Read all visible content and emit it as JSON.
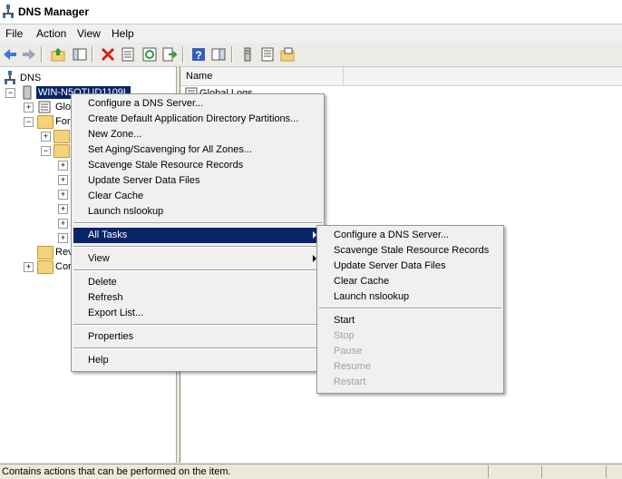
{
  "window": {
    "title": "DNS Manager"
  },
  "menubar": {
    "items": [
      "File",
      "Action",
      "View",
      "Help"
    ]
  },
  "toolbar": {
    "icons": [
      "back-arrow-icon",
      "forward-arrow-icon",
      "up-folder-icon",
      "show-hide-tree-icon",
      "delete-icon",
      "properties-icon",
      "refresh-icon",
      "export-list-icon",
      "help-icon",
      "show-action-pane-icon",
      "server-icon",
      "list-icon",
      "folder-icon"
    ]
  },
  "tree": {
    "root": "DNS",
    "server": "WIN-N5OTUD1109L",
    "global_logs": "Glo",
    "forward": "For",
    "reverse": "Rev",
    "conditional": "Cor"
  },
  "content": {
    "column_name": "Name",
    "first_item": "Global Logs"
  },
  "context_menu": {
    "items": [
      "Configure a DNS Server...",
      "Create Default Application Directory Partitions...",
      "New Zone...",
      "Set Aging/Scavenging for All Zones...",
      "Scavenge Stale Resource Records",
      "Update Server Data Files",
      "Clear Cache",
      "Launch nslookup"
    ],
    "all_tasks": "All Tasks",
    "view": "View",
    "delete": "Delete",
    "refresh": "Refresh",
    "export": "Export List...",
    "properties": "Properties",
    "help": "Help"
  },
  "submenu": {
    "items": [
      "Configure a DNS Server...",
      "Scavenge Stale Resource Records",
      "Update Server Data Files",
      "Clear Cache",
      "Launch nslookup"
    ],
    "start": "Start",
    "stop": "Stop",
    "pause": "Pause",
    "resume": "Resume",
    "restart": "Restart"
  },
  "statusbar": {
    "text": "Contains actions that can be performed on the item."
  }
}
